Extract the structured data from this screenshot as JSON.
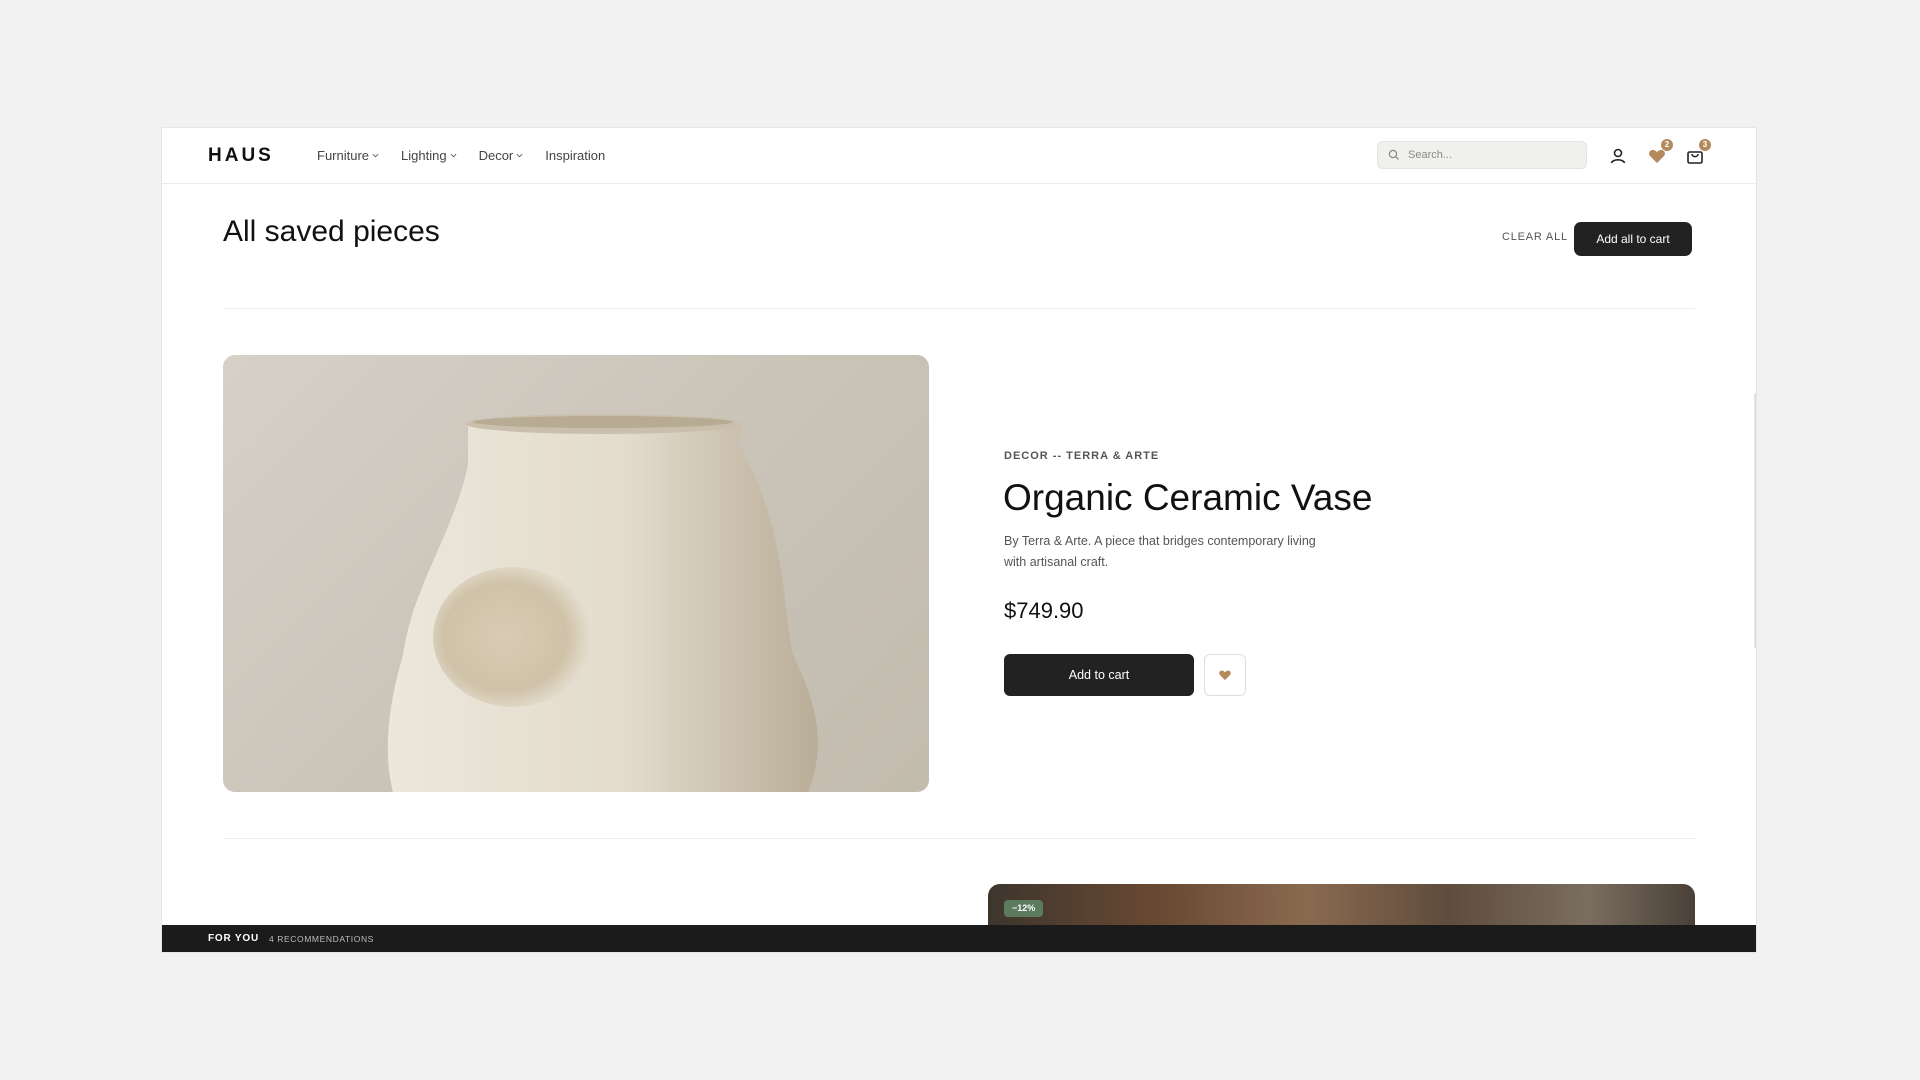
{
  "header": {
    "logo": "HAUS",
    "nav": [
      {
        "label": "Furniture",
        "has_dropdown": true
      },
      {
        "label": "Lighting",
        "has_dropdown": true
      },
      {
        "label": "Decor",
        "has_dropdown": true
      },
      {
        "label": "Inspiration",
        "has_dropdown": false
      }
    ],
    "search": {
      "placeholder": "Search...",
      "value": ""
    },
    "icons": {
      "account": "user-icon",
      "wishlist": "heart-icon",
      "cart": "shopping-bag-icon"
    },
    "wishlist_count": "2",
    "cart_count": "3"
  },
  "page": {
    "title": "All saved pieces",
    "clear_all_label": "CLEAR ALL",
    "add_all_label": "Add all to cart"
  },
  "product": {
    "eyebrow": "DECOR -- TERRA & ARTE",
    "name": "Organic Ceramic Vase",
    "description": "By Terra & Arte. A piece that bridges contemporary living with artisanal craft.",
    "price": "$749.90",
    "add_to_cart_label": "Add to cart",
    "favorited": true
  },
  "next_product": {
    "discount_badge": "−12%"
  },
  "for_you": {
    "title": "FOR YOU",
    "count_label": "4 RECOMMENDATIONS"
  },
  "colors": {
    "accent": "#b48a5c",
    "primary_button": "#222222",
    "discount_badge": "#5c7a5d",
    "footer_bar": "#1b1b1b"
  }
}
